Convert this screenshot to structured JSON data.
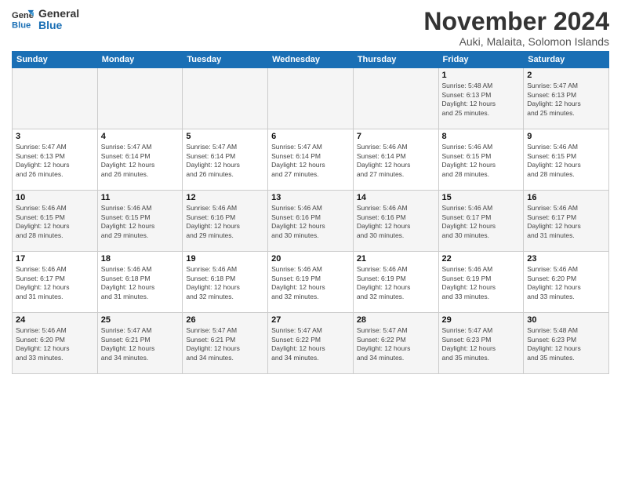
{
  "header": {
    "logo_line1": "General",
    "logo_line2": "Blue",
    "month_title": "November 2024",
    "subtitle": "Auki, Malaita, Solomon Islands"
  },
  "weekdays": [
    "Sunday",
    "Monday",
    "Tuesday",
    "Wednesday",
    "Thursday",
    "Friday",
    "Saturday"
  ],
  "weeks": [
    [
      {
        "day": "",
        "info": ""
      },
      {
        "day": "",
        "info": ""
      },
      {
        "day": "",
        "info": ""
      },
      {
        "day": "",
        "info": ""
      },
      {
        "day": "",
        "info": ""
      },
      {
        "day": "1",
        "info": "Sunrise: 5:48 AM\nSunset: 6:13 PM\nDaylight: 12 hours\nand 25 minutes."
      },
      {
        "day": "2",
        "info": "Sunrise: 5:47 AM\nSunset: 6:13 PM\nDaylight: 12 hours\nand 25 minutes."
      }
    ],
    [
      {
        "day": "3",
        "info": "Sunrise: 5:47 AM\nSunset: 6:13 PM\nDaylight: 12 hours\nand 26 minutes."
      },
      {
        "day": "4",
        "info": "Sunrise: 5:47 AM\nSunset: 6:14 PM\nDaylight: 12 hours\nand 26 minutes."
      },
      {
        "day": "5",
        "info": "Sunrise: 5:47 AM\nSunset: 6:14 PM\nDaylight: 12 hours\nand 26 minutes."
      },
      {
        "day": "6",
        "info": "Sunrise: 5:47 AM\nSunset: 6:14 PM\nDaylight: 12 hours\nand 27 minutes."
      },
      {
        "day": "7",
        "info": "Sunrise: 5:46 AM\nSunset: 6:14 PM\nDaylight: 12 hours\nand 27 minutes."
      },
      {
        "day": "8",
        "info": "Sunrise: 5:46 AM\nSunset: 6:15 PM\nDaylight: 12 hours\nand 28 minutes."
      },
      {
        "day": "9",
        "info": "Sunrise: 5:46 AM\nSunset: 6:15 PM\nDaylight: 12 hours\nand 28 minutes."
      }
    ],
    [
      {
        "day": "10",
        "info": "Sunrise: 5:46 AM\nSunset: 6:15 PM\nDaylight: 12 hours\nand 28 minutes."
      },
      {
        "day": "11",
        "info": "Sunrise: 5:46 AM\nSunset: 6:15 PM\nDaylight: 12 hours\nand 29 minutes."
      },
      {
        "day": "12",
        "info": "Sunrise: 5:46 AM\nSunset: 6:16 PM\nDaylight: 12 hours\nand 29 minutes."
      },
      {
        "day": "13",
        "info": "Sunrise: 5:46 AM\nSunset: 6:16 PM\nDaylight: 12 hours\nand 30 minutes."
      },
      {
        "day": "14",
        "info": "Sunrise: 5:46 AM\nSunset: 6:16 PM\nDaylight: 12 hours\nand 30 minutes."
      },
      {
        "day": "15",
        "info": "Sunrise: 5:46 AM\nSunset: 6:17 PM\nDaylight: 12 hours\nand 30 minutes."
      },
      {
        "day": "16",
        "info": "Sunrise: 5:46 AM\nSunset: 6:17 PM\nDaylight: 12 hours\nand 31 minutes."
      }
    ],
    [
      {
        "day": "17",
        "info": "Sunrise: 5:46 AM\nSunset: 6:17 PM\nDaylight: 12 hours\nand 31 minutes."
      },
      {
        "day": "18",
        "info": "Sunrise: 5:46 AM\nSunset: 6:18 PM\nDaylight: 12 hours\nand 31 minutes."
      },
      {
        "day": "19",
        "info": "Sunrise: 5:46 AM\nSunset: 6:18 PM\nDaylight: 12 hours\nand 32 minutes."
      },
      {
        "day": "20",
        "info": "Sunrise: 5:46 AM\nSunset: 6:19 PM\nDaylight: 12 hours\nand 32 minutes."
      },
      {
        "day": "21",
        "info": "Sunrise: 5:46 AM\nSunset: 6:19 PM\nDaylight: 12 hours\nand 32 minutes."
      },
      {
        "day": "22",
        "info": "Sunrise: 5:46 AM\nSunset: 6:19 PM\nDaylight: 12 hours\nand 33 minutes."
      },
      {
        "day": "23",
        "info": "Sunrise: 5:46 AM\nSunset: 6:20 PM\nDaylight: 12 hours\nand 33 minutes."
      }
    ],
    [
      {
        "day": "24",
        "info": "Sunrise: 5:46 AM\nSunset: 6:20 PM\nDaylight: 12 hours\nand 33 minutes."
      },
      {
        "day": "25",
        "info": "Sunrise: 5:47 AM\nSunset: 6:21 PM\nDaylight: 12 hours\nand 34 minutes."
      },
      {
        "day": "26",
        "info": "Sunrise: 5:47 AM\nSunset: 6:21 PM\nDaylight: 12 hours\nand 34 minutes."
      },
      {
        "day": "27",
        "info": "Sunrise: 5:47 AM\nSunset: 6:22 PM\nDaylight: 12 hours\nand 34 minutes."
      },
      {
        "day": "28",
        "info": "Sunrise: 5:47 AM\nSunset: 6:22 PM\nDaylight: 12 hours\nand 34 minutes."
      },
      {
        "day": "29",
        "info": "Sunrise: 5:47 AM\nSunset: 6:23 PM\nDaylight: 12 hours\nand 35 minutes."
      },
      {
        "day": "30",
        "info": "Sunrise: 5:48 AM\nSunset: 6:23 PM\nDaylight: 12 hours\nand 35 minutes."
      }
    ]
  ]
}
